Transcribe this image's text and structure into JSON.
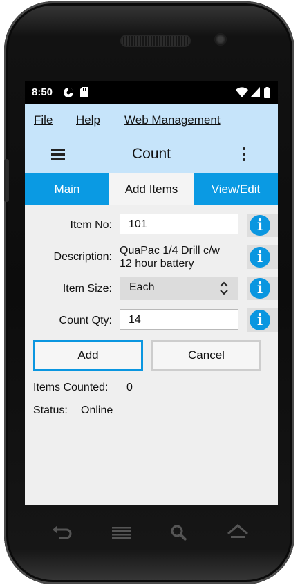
{
  "status_bar": {
    "time": "8:50"
  },
  "menu": {
    "file": "File",
    "help": "Help",
    "web_management": "Web Management"
  },
  "header": {
    "title": "Count"
  },
  "tabs": [
    {
      "label": "Main"
    },
    {
      "label": "Add Items"
    },
    {
      "label": "View/Edit"
    }
  ],
  "form": {
    "item_no": {
      "label": "Item No:",
      "value": "101"
    },
    "description": {
      "label": "Description:",
      "line1": "QuaPac 1/4 Drill c/w",
      "line2": "12 hour battery"
    },
    "item_size": {
      "label": "Item Size:",
      "value": "Each"
    },
    "count_qty": {
      "label": "Count Qty:",
      "value": "14"
    },
    "info_glyph": "i"
  },
  "buttons": {
    "add": "Add",
    "cancel": "Cancel"
  },
  "summary": {
    "items_counted_label": "Items Counted:",
    "items_counted_value": "0",
    "status_label": "Status:",
    "status_value": "Online"
  },
  "icons": [
    "signal-data-icon",
    "sd-card-icon",
    "wifi-icon",
    "cell-signal-icon",
    "battery-icon",
    "menu-icon",
    "more-vert-icon",
    "info-icon",
    "chevron-up-down-icon",
    "back-icon",
    "recent-apps-icon",
    "search-icon",
    "home-icon"
  ],
  "colors": {
    "accent": "#0a9ae3",
    "header_bg": "#c6e4fa",
    "screen_bg": "#efefef"
  }
}
